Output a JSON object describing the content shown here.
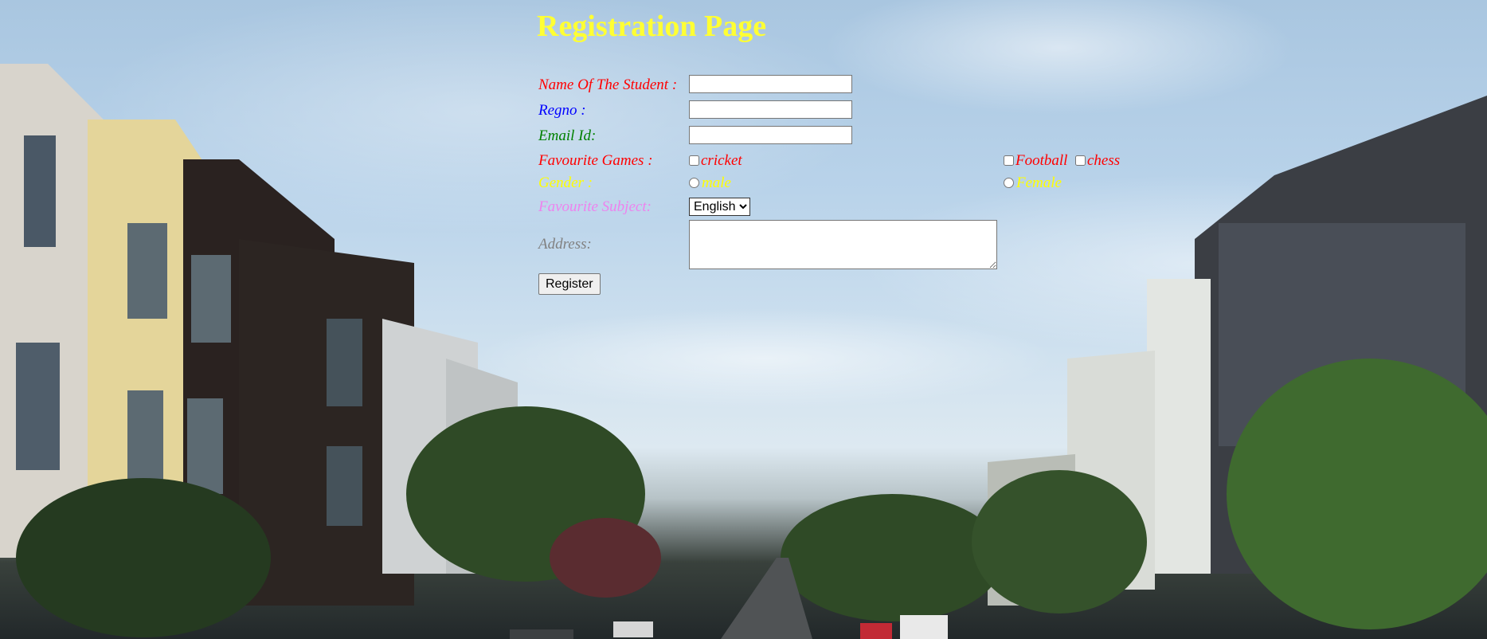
{
  "page": {
    "title": "Registration Page"
  },
  "form": {
    "name_label": "Name Of The Student :",
    "name_value": "",
    "regno_label": "Regno :",
    "regno_value": "",
    "email_label": "Email Id:",
    "email_value": "",
    "games_label": "Favourite Games :",
    "games": [
      {
        "label": "cricket",
        "checked": false
      },
      {
        "label": "Football",
        "checked": false
      },
      {
        "label": "chess",
        "checked": false
      }
    ],
    "gender_label": "Gender :",
    "genders": [
      {
        "label": "male",
        "checked": false
      },
      {
        "label": "Female",
        "checked": false
      }
    ],
    "subject_label": "Favourite Subject:",
    "subject_selected": "English",
    "address_label": "Address:",
    "address_value": "",
    "register_label": "Register"
  },
  "colors": {
    "title": "#ffff33",
    "name_label": "#ff0000",
    "regno_label": "#0000ff",
    "email_label": "#008000",
    "games_label": "#ff0000",
    "gender_label": "#ffff00",
    "subject_label": "#ee82ee",
    "address_label": "#808080"
  }
}
